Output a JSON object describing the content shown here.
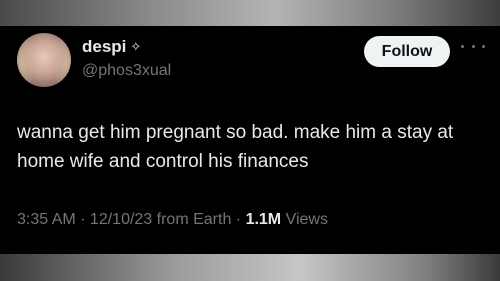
{
  "user": {
    "display_name": "despi",
    "badge_icon": "sparkle-icon",
    "badge_glyph": "✧",
    "handle": "@phos3xual"
  },
  "actions": {
    "follow_label": "Follow",
    "more_icon": "more-horizontal-icon"
  },
  "tweet": {
    "text": "wanna get him pregnant so bad. make him a stay at home wife and control his finances"
  },
  "meta": {
    "time": "3:35 AM",
    "separator_1": " · ",
    "date": "12/10/23 from Earth",
    "separator_2": " · ",
    "views_count": "1.1M",
    "views_label": " Views"
  },
  "colors": {
    "background": "#000000",
    "primary_text": "#e7e9ea",
    "secondary_text": "#71767b",
    "follow_button_bg": "#eff3f4",
    "follow_button_text": "#0f1419"
  }
}
